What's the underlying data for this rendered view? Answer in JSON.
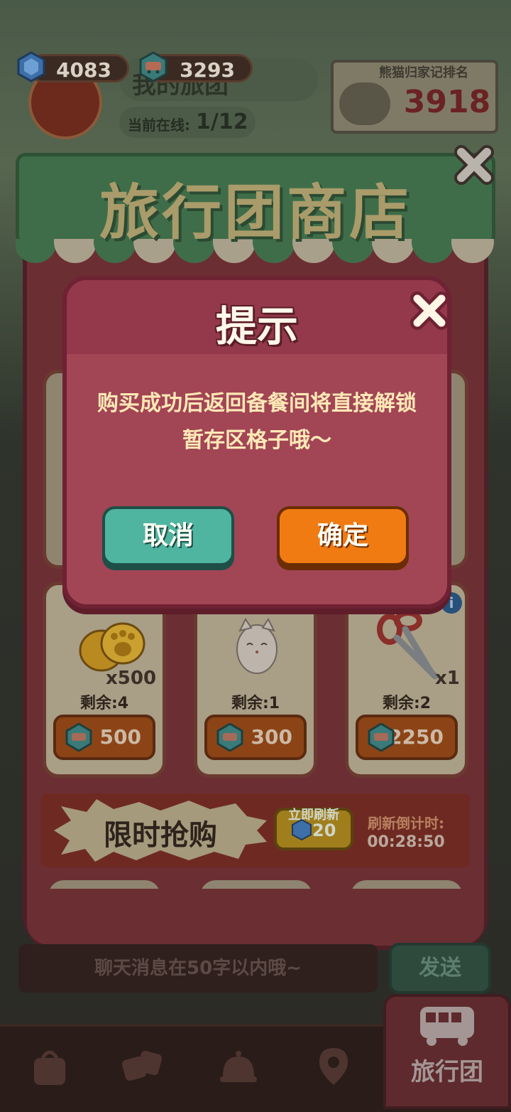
{
  "hud": {
    "gems": "4083",
    "tickets": "3293",
    "team_title_partial": "我的旅团",
    "online_label": "当前在线:",
    "online_value": "1/12",
    "ranking_title": "熊猫归家记排名",
    "ranking_value": "3918"
  },
  "shop": {
    "title": "旅行团商店",
    "items": [
      {
        "name": "paw-coins",
        "qty": "x500",
        "remain": "剩余:4",
        "price": "500"
      },
      {
        "name": "lucky-cat",
        "qty": "",
        "remain": "剩余:1",
        "price": "300"
      },
      {
        "name": "scissors",
        "qty": "x1",
        "remain": "剩余:2",
        "price": "2250"
      }
    ],
    "flash_sale_label": "限时抢购",
    "refresh_label": "立即刷新",
    "refresh_cost": "20",
    "countdown_label": "刷新倒计时:",
    "countdown_value": "00:28:50"
  },
  "dialog": {
    "title": "提示",
    "message": "购买成功后返回备餐间将直接解锁暂存区格子哦～",
    "cancel_label": "取消",
    "confirm_label": "确定"
  },
  "chat": {
    "placeholder": "聊天消息在50字以内哦~",
    "send_label": "发送"
  },
  "nav": {
    "active_label": "旅行团"
  },
  "colors": {
    "dialog_bg": "#a24555",
    "cancel_btn": "#4fb5a1",
    "confirm_btn": "#f07b12",
    "shop_awning": "#3f6d49"
  }
}
